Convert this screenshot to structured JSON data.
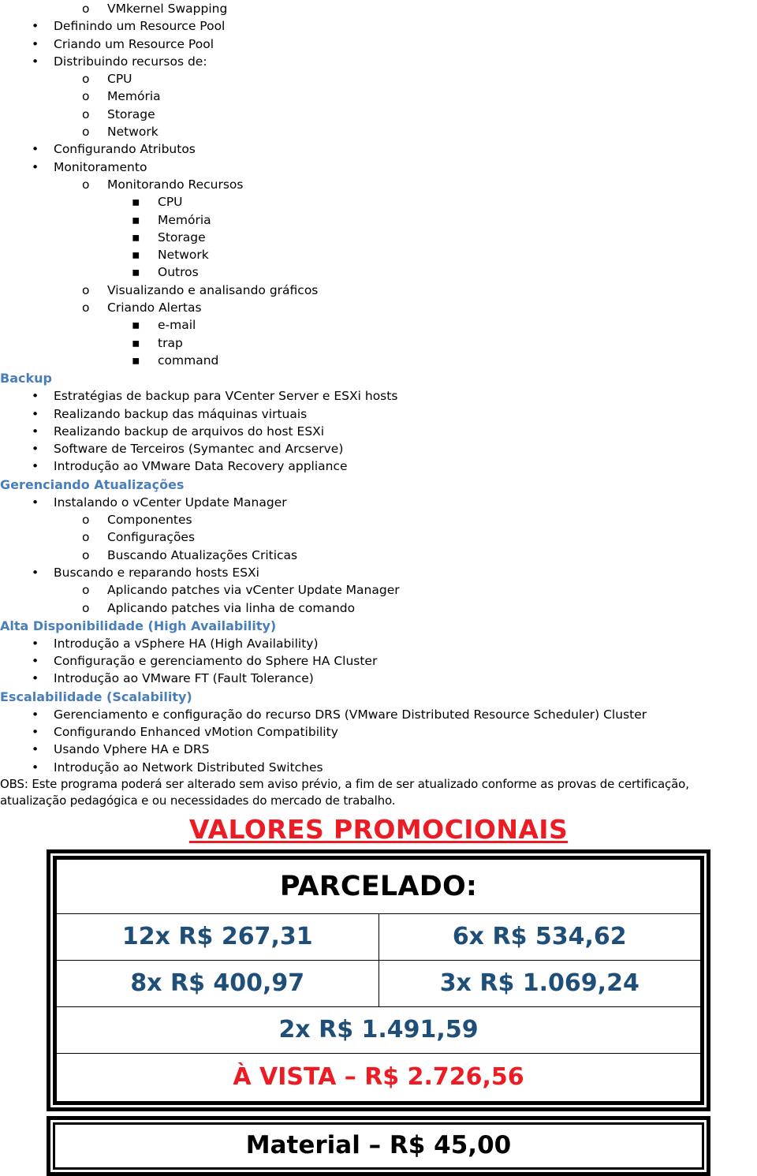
{
  "document": {
    "outline": [
      {
        "level": 2,
        "text": "VMkernel Swapping"
      },
      {
        "level": 1,
        "text": "Definindo um Resource Pool"
      },
      {
        "level": 1,
        "text": "Criando um Resource Pool"
      },
      {
        "level": 1,
        "text": "Distribuindo recursos de:"
      },
      {
        "level": 2,
        "text": "CPU"
      },
      {
        "level": 2,
        "text": "Memória"
      },
      {
        "level": 2,
        "text": "Storage"
      },
      {
        "level": 2,
        "text": "Network"
      },
      {
        "level": 1,
        "text": "Configurando Atributos"
      },
      {
        "level": 1,
        "text": "Monitoramento"
      },
      {
        "level": 2,
        "text": "Monitorando Recursos"
      },
      {
        "level": 3,
        "text": "CPU"
      },
      {
        "level": 3,
        "text": "Memória"
      },
      {
        "level": 3,
        "text": "Storage"
      },
      {
        "level": 3,
        "text": "Network"
      },
      {
        "level": 3,
        "text": "Outros"
      },
      {
        "level": 2,
        "text": "Visualizando e analisando gráficos"
      },
      {
        "level": 2,
        "text": "Criando Alertas"
      },
      {
        "level": 3,
        "text": "e-mail"
      },
      {
        "level": 3,
        "text": "trap"
      },
      {
        "level": 3,
        "text": "command"
      },
      {
        "level": 0,
        "text": "Backup"
      },
      {
        "level": 1,
        "text": "Estratégias de backup para VCenter Server e ESXi hosts"
      },
      {
        "level": 1,
        "text": "Realizando backup das máquinas virtuais"
      },
      {
        "level": 1,
        "text": "Realizando backup de arquivos do host ESXi"
      },
      {
        "level": 1,
        "text": "Software de Terceiros (Symantec and Arcserve)"
      },
      {
        "level": 1,
        "text": "Introdução ao VMware Data Recovery appliance"
      },
      {
        "level": 0,
        "text": "Gerenciando Atualizações"
      },
      {
        "level": 1,
        "text": "Instalando o vCenter Update Manager"
      },
      {
        "level": 2,
        "text": "Componentes"
      },
      {
        "level": 2,
        "text": "Configurações"
      },
      {
        "level": 2,
        "text": "Buscando Atualizações Criticas"
      },
      {
        "level": 1,
        "text": "Buscando e reparando hosts ESXi"
      },
      {
        "level": 2,
        "text": "Aplicando patches via vCenter Update Manager"
      },
      {
        "level": 2,
        "text": "Aplicando patches via linha de comando"
      },
      {
        "level": 0,
        "text": "Alta Disponibilidade (High Availability)"
      },
      {
        "level": 1,
        "text": "Introdução a vSphere HA (High Availability)"
      },
      {
        "level": 1,
        "text": "Configuração e gerenciamento do Sphere HA Cluster"
      },
      {
        "level": 1,
        "text": "Introdução ao VMware FT (Fault Tolerance)"
      },
      {
        "level": 0,
        "text": "Escalabilidade (Scalability)"
      },
      {
        "level": 1,
        "text": "Gerenciamento e configuração do recurso DRS (VMware Distributed Resource Scheduler) Cluster"
      },
      {
        "level": 1,
        "text": "Configurando Enhanced vMotion Compatibility"
      },
      {
        "level": 1,
        "text": "Usando Vphere HA e DRS"
      },
      {
        "level": 1,
        "text": "Introdução ao Network Distributed Switches"
      }
    ],
    "note_lines": [
      "OBS: Este programa poderá ser alterado sem aviso prévio, a fim de ser atualizado conforme as provas de certificação,",
      "atualização pedagógica e ou necessidades do mercado de trabalho."
    ]
  },
  "promo": {
    "title": "VALORES PROMOCIONAIS",
    "table": {
      "header": "PARCELADO:",
      "rows": [
        {
          "left": "12x R$ 267,31",
          "right": "6x R$ 534,62"
        },
        {
          "left": "8x R$ 400,97",
          "right": "3x R$ 1.069,24"
        }
      ],
      "full_rows": [
        {
          "text": "2x R$ 1.491,59",
          "style": "price"
        },
        {
          "text": "À VISTA – R$ 2.726,56",
          "style": "avista"
        }
      ],
      "material": "Material – R$ 45,00"
    }
  },
  "colors": {
    "heading_blue": "#4A7EBB",
    "price_blue": "#1F4E79",
    "promo_red": "#EC1C24",
    "avista_red": "#ED1C24",
    "text_black": "#000000"
  },
  "bullets": {
    "level1": "•",
    "level2": "o",
    "level3": "▪"
  }
}
